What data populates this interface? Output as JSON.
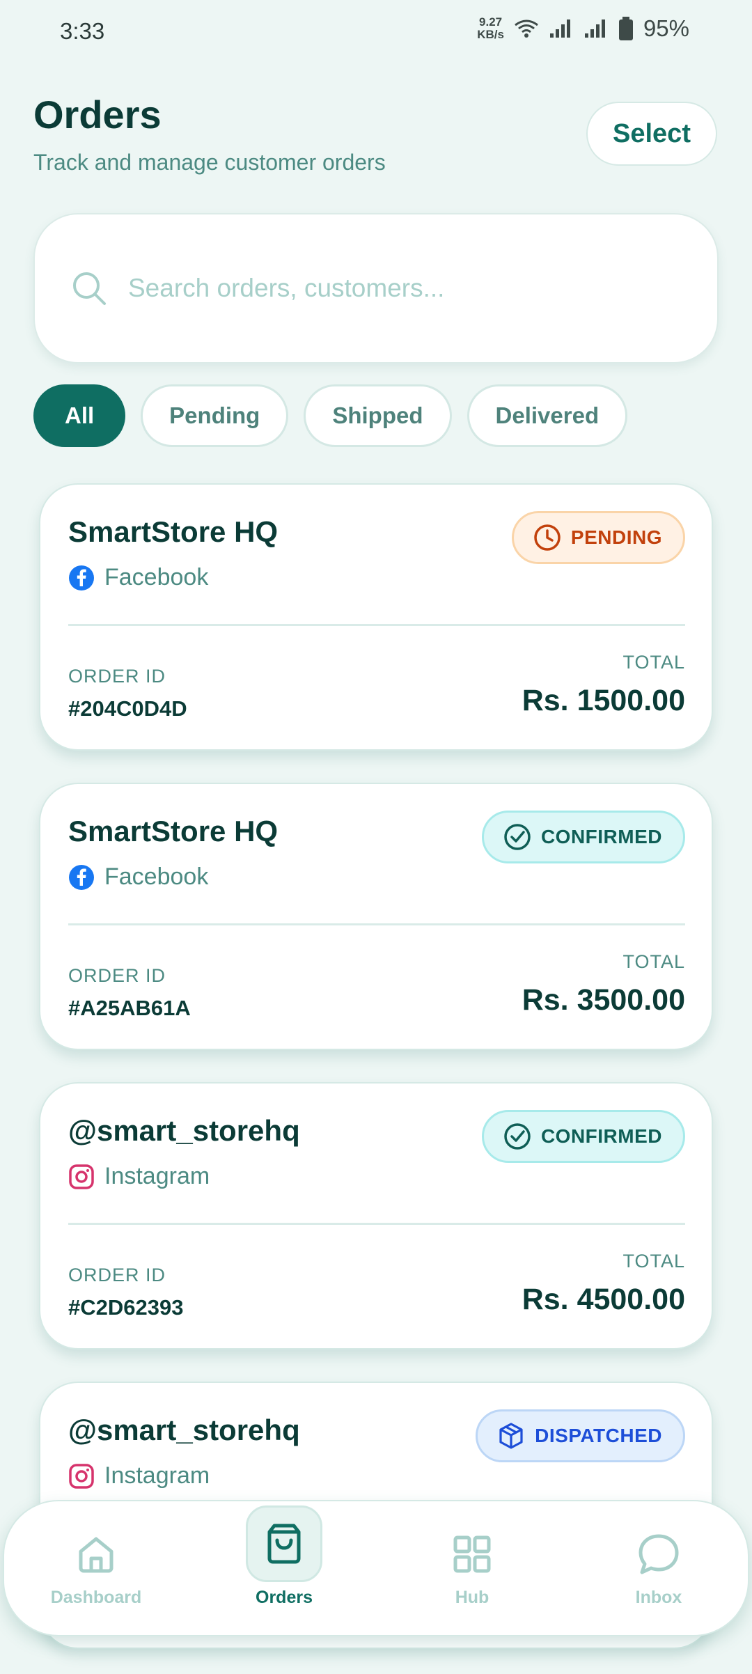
{
  "status_bar": {
    "time": "3:33",
    "network_speed_value": "9.27",
    "network_speed_unit": "KB/s",
    "battery": "95%"
  },
  "header": {
    "title": "Orders",
    "subtitle": "Track and manage customer orders",
    "select_label": "Select"
  },
  "search": {
    "placeholder": "Search orders, customers..."
  },
  "filters": [
    {
      "label": "All",
      "active": true
    },
    {
      "label": "Pending",
      "active": false
    },
    {
      "label": "Shipped",
      "active": false
    },
    {
      "label": "Delivered",
      "active": false
    }
  ],
  "order_labels": {
    "order_id": "ORDER ID",
    "total": "TOTAL"
  },
  "orders": [
    {
      "customer": "SmartStore HQ",
      "platform": "Facebook",
      "platform_icon": "facebook-icon",
      "status": "PENDING",
      "status_icon": "clock-icon",
      "order_id": "#204C0D4D",
      "total": "Rs. 1500.00"
    },
    {
      "customer": "SmartStore HQ",
      "platform": "Facebook",
      "platform_icon": "facebook-icon",
      "status": "CONFIRMED",
      "status_icon": "check-circle-icon",
      "order_id": "#A25AB61A",
      "total": "Rs. 3500.00"
    },
    {
      "customer": "@smart_storehq",
      "platform": "Instagram",
      "platform_icon": "instagram-icon",
      "status": "CONFIRMED",
      "status_icon": "check-circle-icon",
      "order_id": "#C2D62393",
      "total": "Rs. 4500.00"
    },
    {
      "customer": "@smart_storehq",
      "platform": "Instagram",
      "platform_icon": "instagram-icon",
      "status": "DISPATCHED",
      "status_icon": "package-icon",
      "order_id": "",
      "total": ""
    }
  ],
  "bottom_nav": [
    {
      "label": "Dashboard",
      "icon": "home-icon",
      "active": false
    },
    {
      "label": "Orders",
      "icon": "shopping-bag-icon",
      "active": true
    },
    {
      "label": "Hub",
      "icon": "grid-icon",
      "active": false
    },
    {
      "label": "Inbox",
      "icon": "chat-bubble-icon",
      "active": false
    }
  ],
  "colors": {
    "primary": "#0f6e62",
    "background": "#edf6f4",
    "pending": "#c2410c",
    "confirmed": "#0f5e56",
    "dispatched": "#1d4ed8",
    "facebook": "#1877f2",
    "instagram": "#d6336c"
  }
}
